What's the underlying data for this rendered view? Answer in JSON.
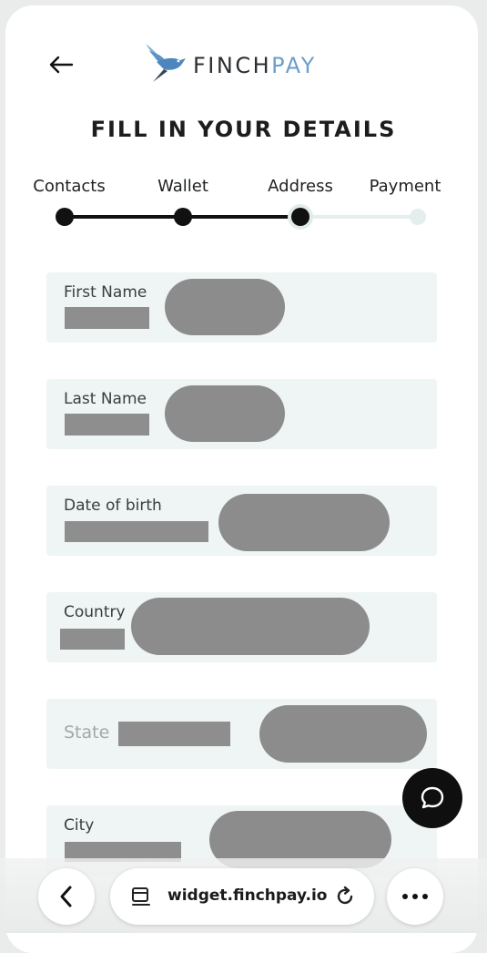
{
  "header": {
    "brand_part1": "FINCH",
    "brand_part2": "PAY",
    "title": "FILL IN YOUR DETAILS"
  },
  "steps": [
    {
      "label": "Contacts",
      "status": "complete"
    },
    {
      "label": "Wallet",
      "status": "complete"
    },
    {
      "label": "Address",
      "status": "current"
    },
    {
      "label": "Payment",
      "status": "pending"
    }
  ],
  "form": {
    "first_name_label": "First Name",
    "last_name_label": "Last Name",
    "dob_label": "Date of birth",
    "country_label": "Country",
    "state_placeholder": "State",
    "city_label": "City"
  },
  "browser": {
    "url": "widget.finchpay.io"
  },
  "icons": {
    "back": "arrow-left-icon",
    "logo": "finch-bird-logo",
    "chat": "chat-bubble-icon",
    "browser_back": "chevron-left-icon",
    "tabs": "tab-switcher-icon",
    "reload": "reload-icon",
    "more": "more-dots-icon"
  },
  "colors": {
    "accent_blue": "#6b9ec9",
    "field_bg": "#eef5f4",
    "progress": "#111111"
  }
}
